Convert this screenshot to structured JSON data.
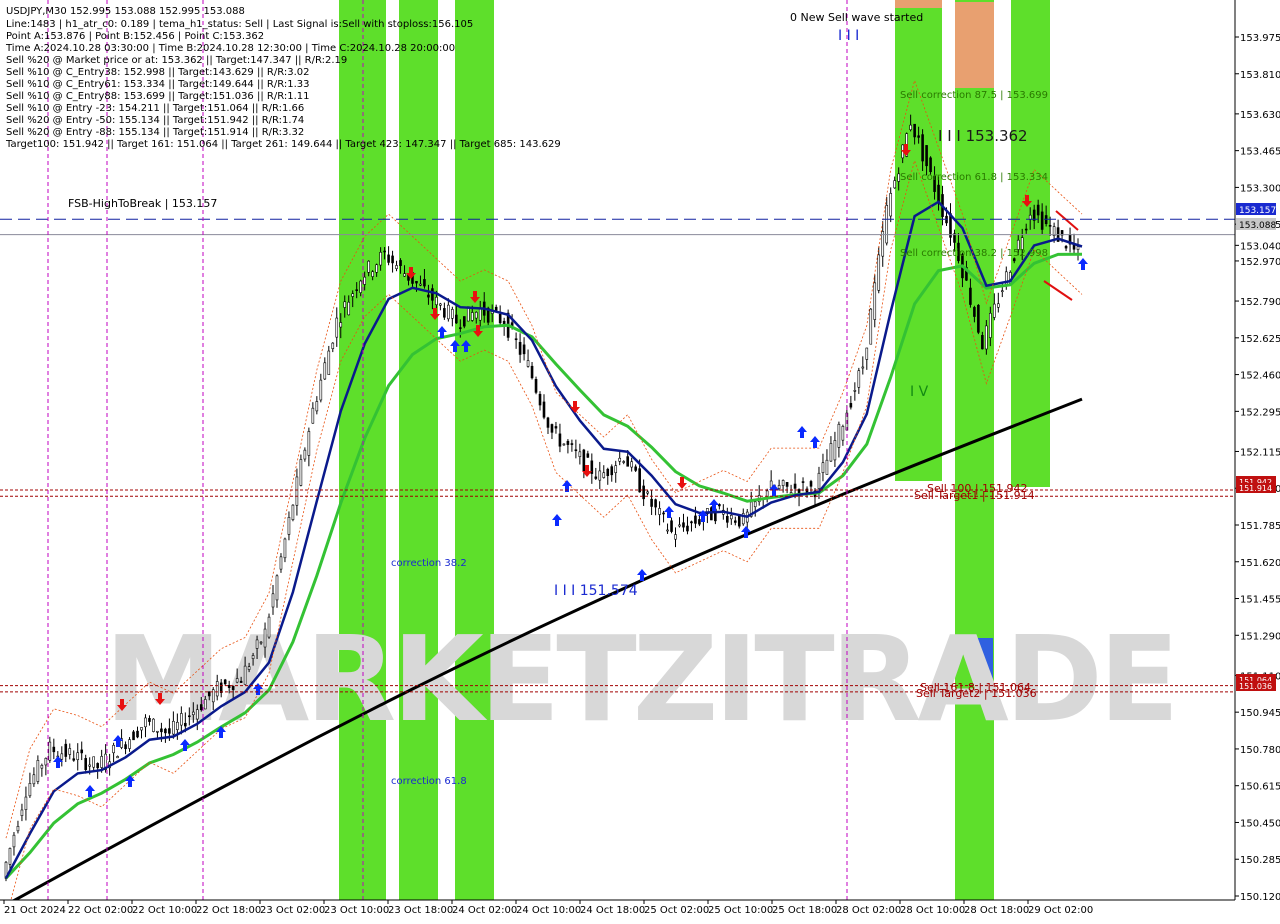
{
  "header": {
    "symbol_line": "USDJPY,M30  152.995 153.088 152.995 153.088",
    "info_lines": [
      "Line:1483  |  h1_atr_c0: 0.189  |  tema_h1_status: Sell  |  Last Signal is:Sell with stoploss:156.105",
      "Point A:153.876  |  Point B:152.456  |  Point C:153.362",
      "Time A:2024.10.28 03:30:00  |  Time B:2024.10.28 12:30:00  |  Time C:2024.10.28 20:00:00",
      "Sell %20 @ Market price or at: 153.362  ||  Target:147.347  ||  R/R:2.19",
      "Sell %10 @ C_Entry38: 152.998  ||  Target:143.629  ||  R/R:3.02",
      "Sell %10 @ C_Entry61: 153.334  ||  Target:149.644  ||  R/R:1.33",
      "Sell %10 @ C_Entry88: 153.699  ||  Target:151.036  ||  R/R:1.11",
      "Sell %10 @ Entry -23: 154.211  ||  Target:151.064  ||  R/R:1.66",
      "Sell %20 @ Entry -50: 155.134  ||  Target:151.942  ||  R/R:1.74",
      "Sell %20 @ Entry -88: 155.134  ||  Target:151.914  ||  R/R:3.32",
      "Target100: 151.942  ||  Target 161: 151.064  ||  Target 261: 149.644  ||  Target 423: 147.347  ||  Target 685: 143.629"
    ]
  },
  "annotations": {
    "fsb": "FSB-HighToBreak  |  153.157",
    "new_wave": "0 New Sell wave started",
    "wave_iii_top": "I I I",
    "wave_iii_low": "I I I 151.574",
    "wave_iii_c": "I I I 153.362",
    "wave_iv": "I V",
    "sell_corr_875": "Sell correction 87.5 | 153.699",
    "sell_corr_618": "Sell correction 61.8 | 153.334",
    "sell_corr_382": "Sell correction 38.2 | 152.998",
    "correction_382": "correction 38.2",
    "correction_618": "correction 61.8",
    "sell_100": "Sell 100 | 151.942",
    "sell_target1": "Sell Target1 | 151.914",
    "sell_161": "Sell 161.8 | 151.064",
    "sell_target2": "Sell Target2 | 151.036",
    "watermark": "MARKETZITRADE"
  },
  "price_tags": {
    "current": "153.088",
    "fsb": "153.157",
    "t1a": "151.942",
    "t1b": "151.914",
    "t2a": "151.064",
    "t2b": "151.036"
  },
  "colors": {
    "green_zone": "#4cdc14",
    "orange_zone": "#e8a070",
    "blue_zone": "#3060e0",
    "ema_fast": "#0a1a8c",
    "ema_mid": "#34c234",
    "ema_slow": "#000000",
    "envelope": "#e85010",
    "target_lines": "#a00000",
    "fsb_line": "#1020a0",
    "magenta_lines": "#c000c0",
    "buy_arrow": "#0a2aff",
    "sell_arrow": "#e81010"
  },
  "chart_data": {
    "type": "line",
    "symbol": "USDJPY",
    "timeframe": "M30",
    "ylim": [
      150.1,
      154.03
    ],
    "y_ticks": [
      "153.975",
      "153.810",
      "153.630",
      "153.465",
      "153.300",
      "153.135",
      "153.040",
      "152.970",
      "152.790",
      "152.625",
      "152.460",
      "152.295",
      "152.115",
      "151.950",
      "151.785",
      "151.620",
      "151.455",
      "151.290",
      "151.110",
      "150.945",
      "150.780",
      "150.615",
      "150.450",
      "150.285",
      "150.120"
    ],
    "x_ticks": [
      "21 Oct 2024",
      "22 Oct 02:00",
      "22 Oct 10:00",
      "22 Oct 18:00",
      "23 Oct 02:00",
      "23 Oct 10:00",
      "23 Oct 18:00",
      "24 Oct 02:00",
      "24 Oct 10:00",
      "24 Oct 18:00",
      "25 Oct 02:00",
      "25 Oct 10:00",
      "25 Oct 18:00",
      "28 Oct 02:00",
      "28 Oct 10:00",
      "28 Oct 18:00",
      "29 Oct 02:00"
    ],
    "levels": {
      "fsb_high_to_break": 153.157,
      "current_price": 153.088,
      "sell_100": 151.942,
      "sell_target1": 151.914,
      "sell_161_8": 151.064,
      "sell_target2": 151.036,
      "point_a": 153.876,
      "point_b": 152.456,
      "point_c": 153.362
    },
    "series": [
      {
        "name": "close",
        "values": [
          150.2,
          150.6,
          150.78,
          150.75,
          150.7,
          150.8,
          150.9,
          150.85,
          150.95,
          151.05,
          151.1,
          151.3,
          151.8,
          152.3,
          152.7,
          152.9,
          153.0,
          152.9,
          152.8,
          152.7,
          152.75,
          152.7,
          152.5,
          152.2,
          152.1,
          152.0,
          152.1,
          151.9,
          151.75,
          151.8,
          151.85,
          151.8,
          151.95,
          151.95,
          151.95,
          152.2,
          152.5,
          153.2,
          153.6,
          153.3,
          153.0,
          152.6,
          152.9,
          153.2,
          153.1,
          153.0
        ]
      }
    ]
  }
}
